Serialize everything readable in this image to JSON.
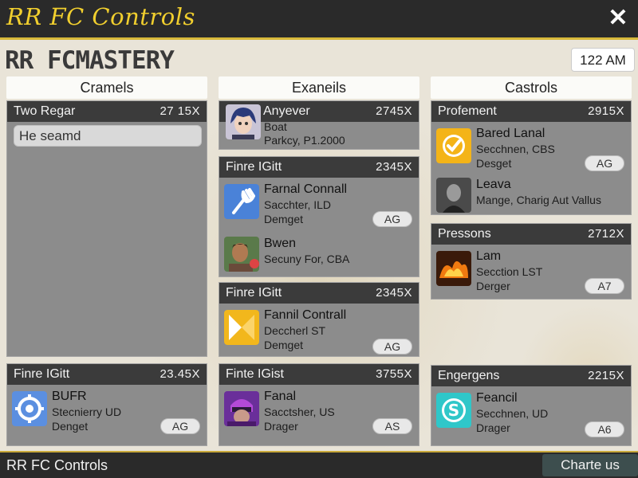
{
  "window": {
    "title": "RR FC Controls"
  },
  "app_heading": "RR FCMASTERY",
  "clock": "122 AM",
  "columns": [
    {
      "header": "Cramels"
    },
    {
      "header": "Exaneils"
    },
    {
      "header": "Castrols"
    }
  ],
  "col1": {
    "card1": {
      "title": "Two Regar",
      "price": "27 15X",
      "search_value": "He seamd"
    },
    "card2": {
      "title": "Finre IGitt",
      "price": "23.45X",
      "entry": {
        "name": "BUFR",
        "sub1": "Stecnierry UD",
        "sub2": "Denget",
        "tag": "AG"
      }
    }
  },
  "col2": {
    "card1": {
      "title": "Anyever",
      "price": "2745X",
      "entry": {
        "sub1": "Boat",
        "sub2": "Parkcy, P1.2000"
      }
    },
    "card2": {
      "title": "Finre IGitt",
      "price": "2345X",
      "entries": [
        {
          "name": "Farnal Connall",
          "sub1": "Sacchter, ILD",
          "sub2": "Demget",
          "tag": "AG"
        },
        {
          "name": "Bwen",
          "sub1": "Secuny For, CBA"
        }
      ]
    },
    "card3": {
      "title": "Finre IGitt",
      "price": "2345X",
      "entry": {
        "name": "Fannil Contrall",
        "sub1": "Deccherl ST",
        "sub2": "Demget",
        "tag": "AG"
      }
    },
    "card4": {
      "title": "Finte IGist",
      "price": "3755X",
      "entry": {
        "name": "Fanal",
        "sub1": "Sacctsher, US",
        "sub2": "Drager",
        "tag": "AS"
      }
    }
  },
  "col3": {
    "card1": {
      "title": "Profement",
      "price": "2915X",
      "entries": [
        {
          "name": "Bared Lanal",
          "sub1": "Secchnen, CBS",
          "sub2": "Desget",
          "tag": "AG"
        },
        {
          "name": "Leava",
          "sub1": "Mange, Charig Aut Vallus"
        }
      ]
    },
    "card2": {
      "title": "Pressons",
      "price": "2712X",
      "entry": {
        "name": "Lam",
        "sub1": "Secction LST",
        "sub2": "Derger",
        "tag": "A7"
      }
    },
    "card3": {
      "title": "Engergens",
      "price": "2215X",
      "entry": {
        "name": "Feancil",
        "sub1": "Secchnen, UD",
        "sub2": "Drager",
        "tag": "A6"
      }
    }
  },
  "footer": {
    "title": "RR FC Controls",
    "button": "Charte us"
  },
  "colors": {
    "accent": "#f1cf2e",
    "title_bar": "#2a2a2a",
    "card": "#8c8c8c",
    "card_header": "#3b3b3b"
  }
}
